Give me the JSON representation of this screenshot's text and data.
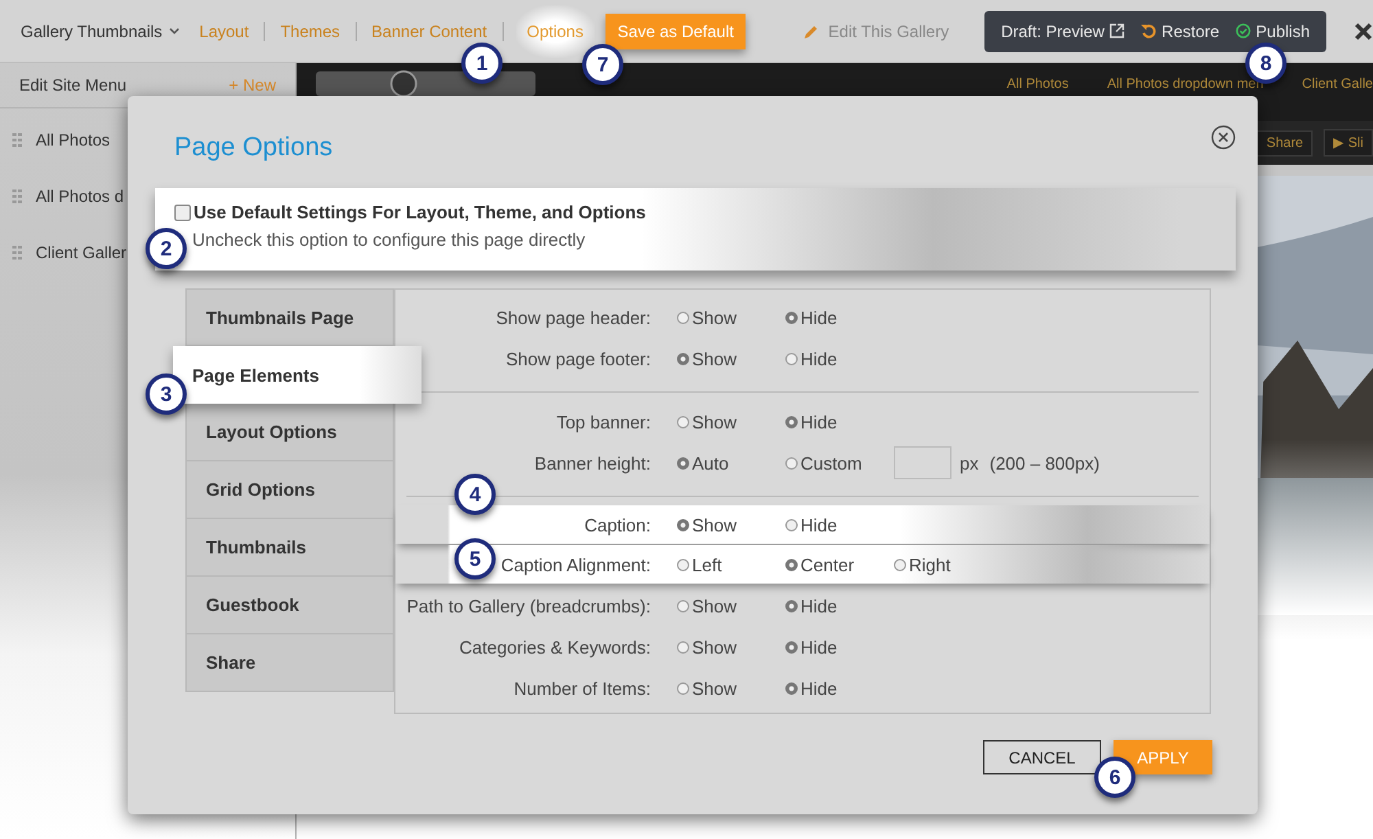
{
  "top_bar": {
    "gallery_menu": "Gallery Thumbnails",
    "nav": [
      {
        "label": "Layout",
        "selected": false
      },
      {
        "label": "Themes",
        "selected": false
      },
      {
        "label": "Banner Content",
        "selected": false
      },
      {
        "label": "Options",
        "selected": true
      }
    ],
    "save_default": "Save as Default",
    "edit_gallery": "Edit This Gallery",
    "draft_preview": "Draft: Preview",
    "restore": "Restore",
    "publish": "Publish"
  },
  "sidebar": {
    "title": "Edit Site Menu",
    "new": "+ New",
    "items": [
      "All Photos",
      "All Photos d",
      "Client Galler"
    ]
  },
  "site": {
    "nav": [
      "All Photos",
      "All Photos dropdown men",
      "Client Galle"
    ],
    "buttons": [
      "Share",
      "▶ Sli"
    ]
  },
  "dialog": {
    "title": "Page Options",
    "defaults": {
      "label": "Use Default Settings For Layout, Theme, and Options",
      "hint": "Uncheck this option to configure this page directly",
      "checked": false
    },
    "tabs": [
      {
        "label": "Thumbnails Page",
        "selected": false
      },
      {
        "label": "Page Elements",
        "selected": true
      },
      {
        "label": "Layout Options",
        "selected": false
      },
      {
        "label": "Grid Options",
        "selected": false
      },
      {
        "label": "Thumbnails",
        "selected": false
      },
      {
        "label": "Guestbook",
        "selected": false
      },
      {
        "label": "Share",
        "selected": false
      }
    ],
    "groups": [
      [
        {
          "kind": "radio",
          "label": "Show page header:",
          "highlighted": false,
          "options": [
            {
              "label": "Show",
              "selected": false
            },
            {
              "label": "Hide",
              "selected": true
            }
          ]
        },
        {
          "kind": "radio",
          "label": "Show page footer:",
          "highlighted": false,
          "options": [
            {
              "label": "Show",
              "selected": true
            },
            {
              "label": "Hide",
              "selected": false
            }
          ]
        }
      ],
      [
        {
          "kind": "radio",
          "label": "Top banner:",
          "highlighted": false,
          "options": [
            {
              "label": "Show",
              "selected": false
            },
            {
              "label": "Hide",
              "selected": true
            }
          ]
        },
        {
          "kind": "radio_input",
          "label": "Banner height:",
          "highlighted": false,
          "options": [
            {
              "label": "Auto",
              "selected": true
            },
            {
              "label": "Custom",
              "selected": false
            }
          ],
          "unit": "px",
          "hint": "(200 – 800px)"
        }
      ],
      [
        {
          "kind": "radio",
          "label": "Caption:",
          "highlighted": true,
          "options": [
            {
              "label": "Show",
              "selected": true
            },
            {
              "label": "Hide",
              "selected": false
            }
          ]
        },
        {
          "kind": "radio",
          "label": "Caption Alignment:",
          "highlighted": true,
          "options": [
            {
              "label": "Left",
              "selected": false
            },
            {
              "label": "Center",
              "selected": true
            },
            {
              "label": "Right",
              "selected": false
            }
          ]
        },
        {
          "kind": "radio",
          "label": "Path to Gallery (breadcrumbs):",
          "highlighted": false,
          "options": [
            {
              "label": "Show",
              "selected": false
            },
            {
              "label": "Hide",
              "selected": true
            }
          ]
        },
        {
          "kind": "radio",
          "label": "Categories & Keywords:",
          "highlighted": false,
          "options": [
            {
              "label": "Show",
              "selected": false
            },
            {
              "label": "Hide",
              "selected": true
            }
          ]
        },
        {
          "kind": "radio",
          "label": "Number of Items:",
          "highlighted": false,
          "options": [
            {
              "label": "Show",
              "selected": false
            },
            {
              "label": "Hide",
              "selected": true
            }
          ]
        }
      ]
    ],
    "cancel": "CANCEL",
    "apply": "APPLY"
  },
  "callouts": [
    "1",
    "7",
    "8",
    "2",
    "3",
    "4",
    "5",
    "6"
  ]
}
